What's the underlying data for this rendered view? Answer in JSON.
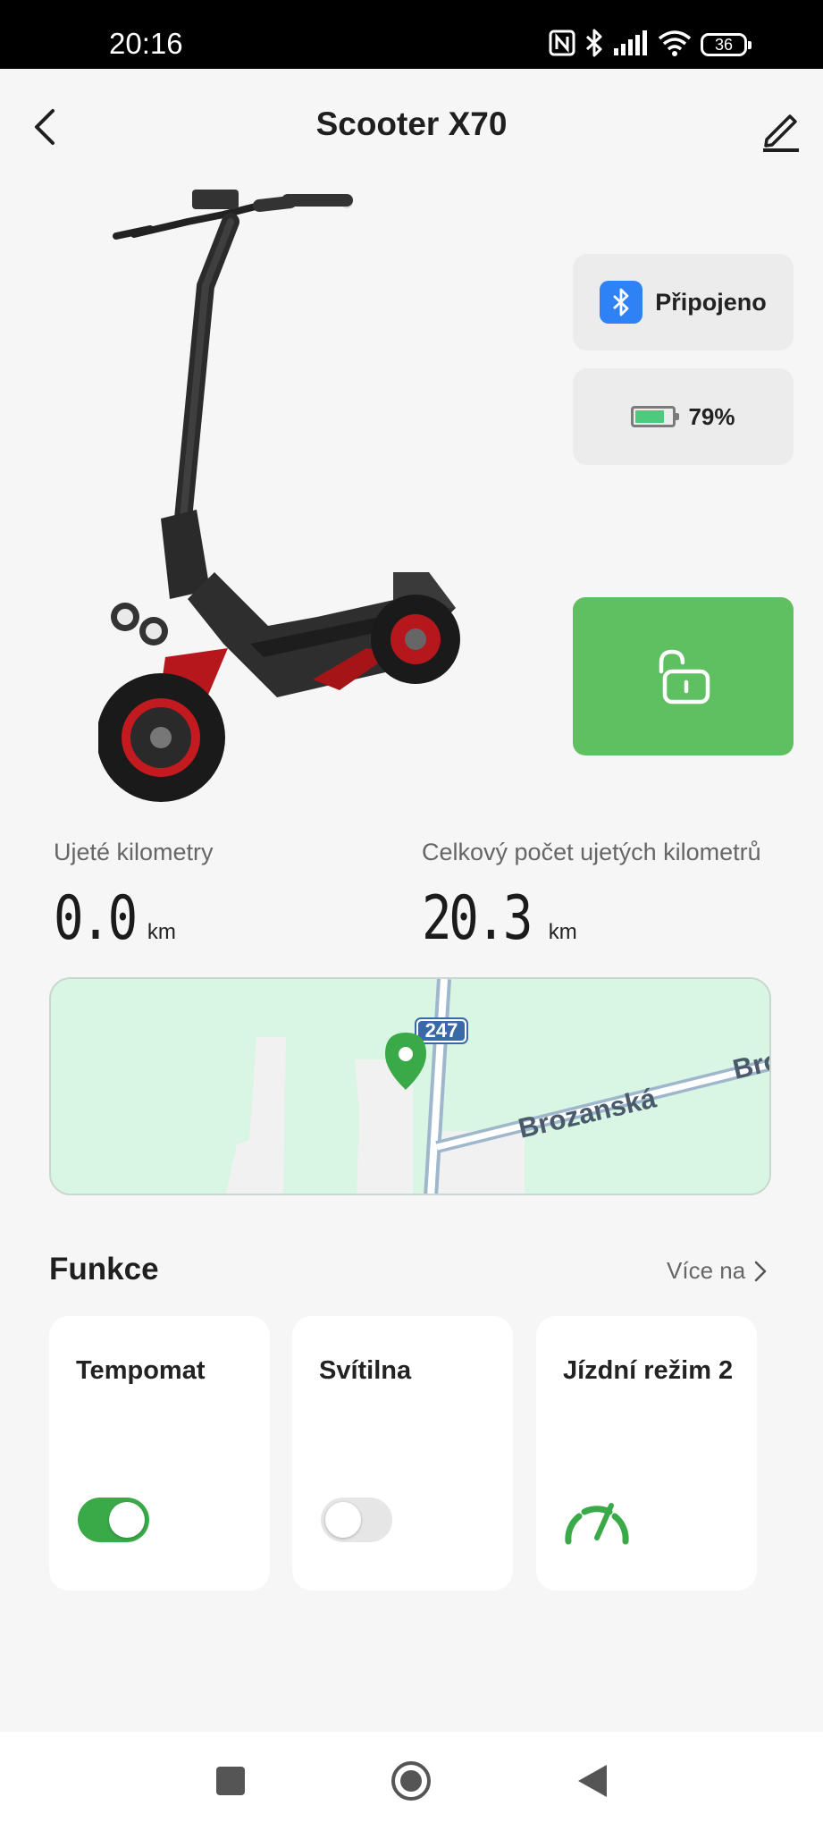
{
  "status_bar": {
    "time": "20:16",
    "battery_level": "36"
  },
  "header": {
    "title": "Scooter X70"
  },
  "status": {
    "connection_label": "Připojeno",
    "battery_label": "79%",
    "battery_fraction": 0.79
  },
  "stats": {
    "trip": {
      "label": "Ujeté kilometry",
      "value": "0.0",
      "unit": "km"
    },
    "total": {
      "label": "Celkový počet ujetých kilometrů",
      "value": "20.3",
      "unit": "km"
    }
  },
  "map": {
    "road_number": "247",
    "street_name": "Brozanská",
    "street_name_cut": "Bro"
  },
  "features": {
    "title": "Funkce",
    "more_label": "Více na",
    "items": [
      {
        "name": "Tempomat",
        "state": "on"
      },
      {
        "name": "Svítilna",
        "state": "off"
      },
      {
        "name": "Jízdní režim 2",
        "state": "gauge"
      }
    ]
  },
  "colors": {
    "accent_green": "#5fc062",
    "toggle_green": "#3aaa49",
    "bluetooth_blue": "#2f82f5",
    "map_green": "#d9f5e3"
  }
}
